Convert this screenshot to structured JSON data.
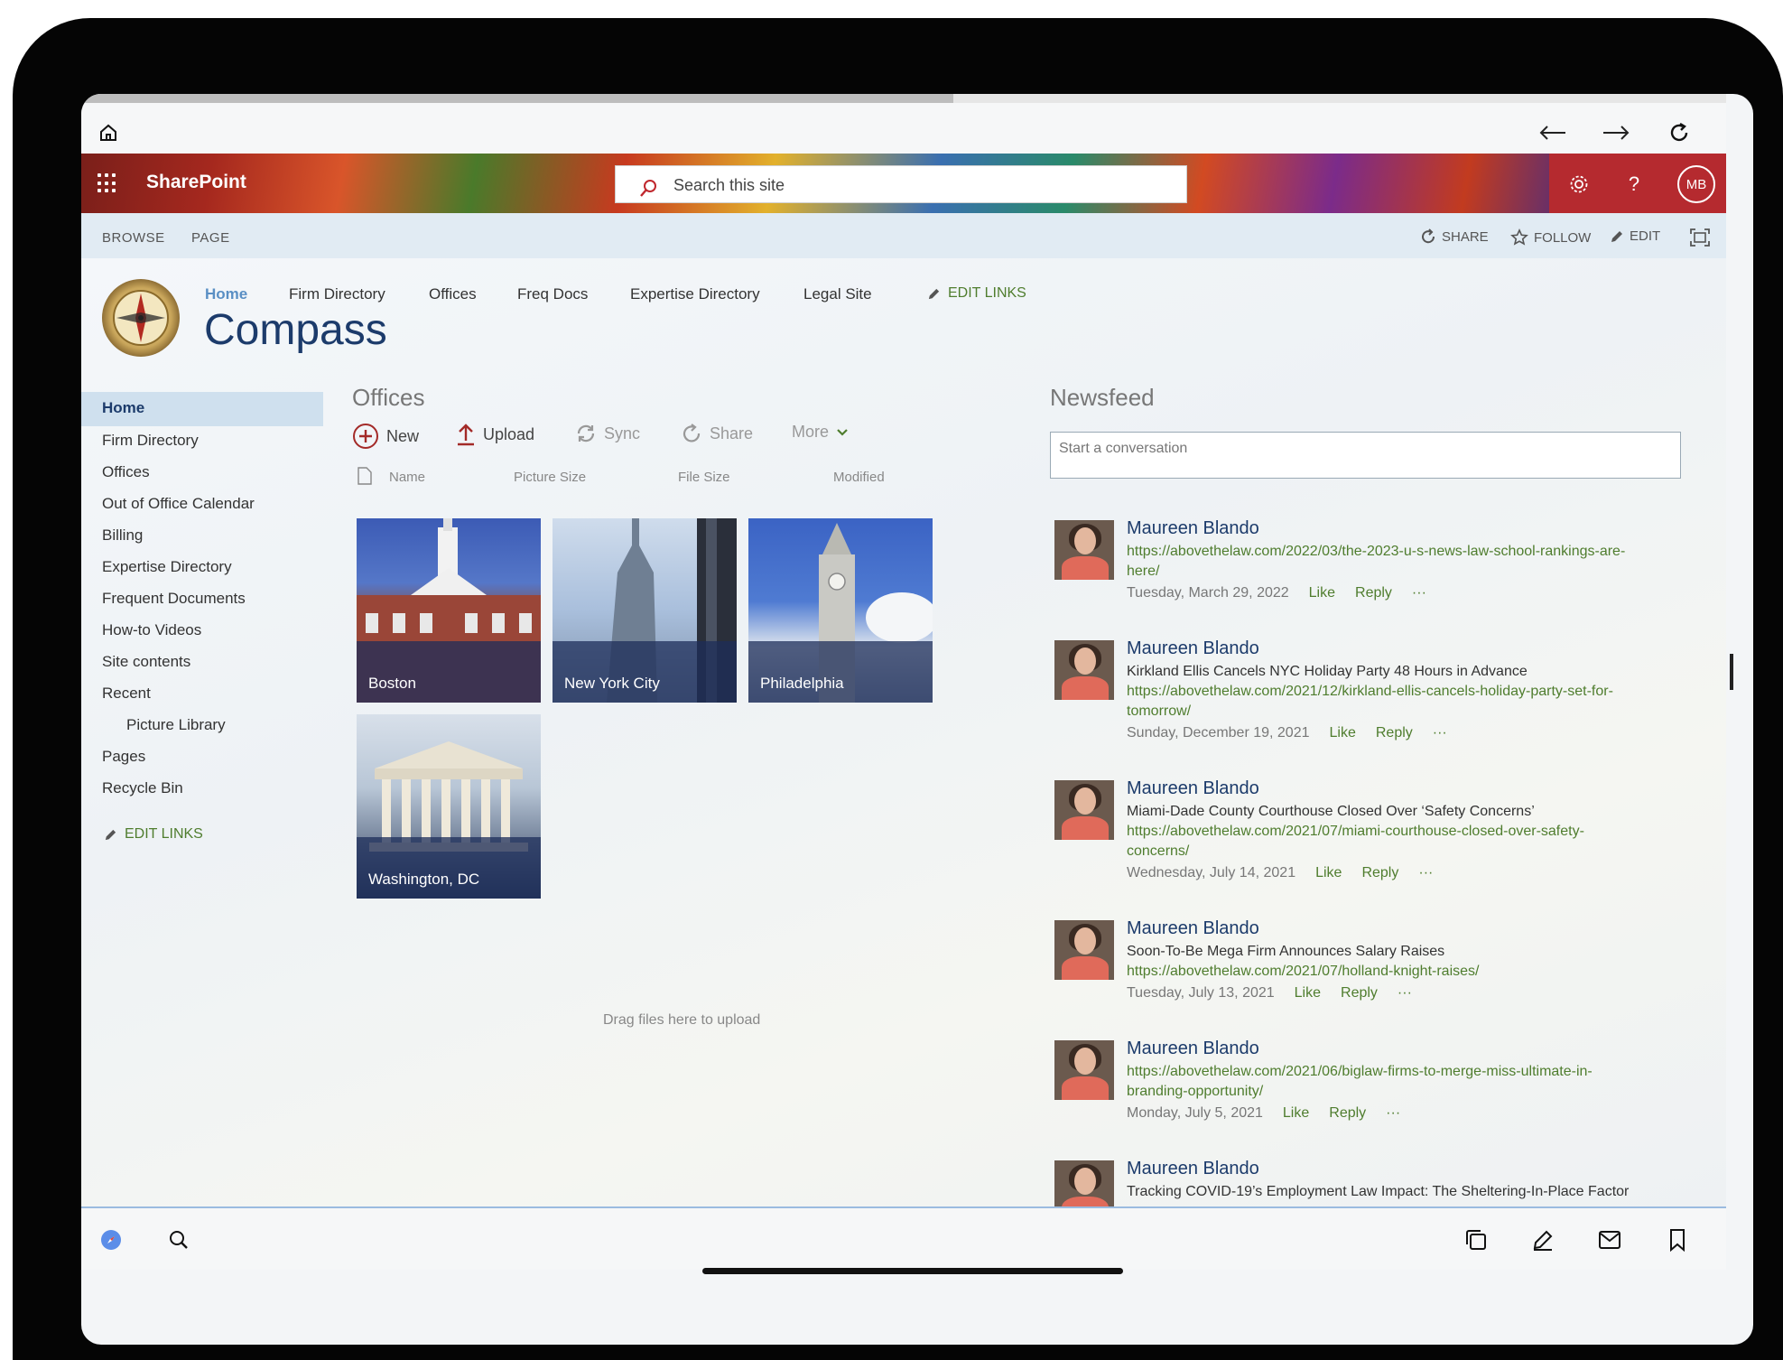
{
  "browser": {
    "loaded_fraction": 0.53
  },
  "suite": {
    "brand": "SharePoint",
    "search_placeholder": "Search this site",
    "avatar_initials": "MB",
    "help_label": "?"
  },
  "ribbon": {
    "tabs": [
      "BROWSE",
      "PAGE"
    ],
    "share": "SHARE",
    "follow": "FOLLOW",
    "edit": "EDIT"
  },
  "topnav": {
    "items": [
      "Home",
      "Firm Directory",
      "Offices",
      "Freq Docs",
      "Expertise Directory",
      "Legal Site"
    ],
    "edit_links": "EDIT LINKS"
  },
  "site_title": "Compass",
  "quicklaunch": {
    "items": [
      "Home",
      "Firm Directory",
      "Offices",
      "Out of Office Calendar",
      "Billing",
      "Expertise Directory",
      "Frequent Documents",
      "How-to Videos",
      "Site contents",
      "Recent",
      "Picture Library",
      "Pages",
      "Recycle Bin"
    ],
    "edit_links": "EDIT LINKS"
  },
  "offices": {
    "title": "Offices",
    "toolbar": {
      "new": "New",
      "upload": "Upload",
      "sync": "Sync",
      "share": "Share",
      "more": "More"
    },
    "columns": [
      "Name",
      "Picture Size",
      "File Size",
      "Modified"
    ],
    "tiles": [
      "Boston",
      "New York City",
      "Philadelphia",
      "Washington, DC"
    ],
    "drag_text": "Drag files here to upload"
  },
  "newsfeed": {
    "title": "Newsfeed",
    "placeholder": "Start a conversation",
    "like": "Like",
    "reply": "Reply",
    "more": "···",
    "posts": [
      {
        "author": "Maureen Blando",
        "headline": "",
        "link1": "https://abovethelaw.com/2022/03/the-2023-u-s-news-law-school-rankings-are-",
        "link2": "here/",
        "date": "Tuesday, March 29, 2022"
      },
      {
        "author": "Maureen Blando",
        "headline": "Kirkland Ellis Cancels NYC Holiday Party 48 Hours in Advance",
        "link1": "https://abovethelaw.com/2021/12/kirkland-ellis-cancels-holiday-party-set-for-",
        "link2": "tomorrow/",
        "date": "Sunday, December 19, 2021"
      },
      {
        "author": "Maureen Blando",
        "headline": "Miami-Dade County Courthouse Closed Over ‘Safety Concerns’",
        "link1": "https://abovethelaw.com/2021/07/miami-courthouse-closed-over-safety-",
        "link2": "concerns/",
        "date": "Wednesday, July 14, 2021"
      },
      {
        "author": "Maureen Blando",
        "headline": "Soon-To-Be Mega Firm Announces Salary Raises",
        "link1": "https://abovethelaw.com/2021/07/holland-knight-raises/",
        "link2": "",
        "date": "Tuesday, July 13, 2021"
      },
      {
        "author": "Maureen Blando",
        "headline": "",
        "link1": "https://abovethelaw.com/2021/06/biglaw-firms-to-merge-miss-ultimate-in-",
        "link2": "branding-opportunity/",
        "date": "Monday, July 5, 2021"
      },
      {
        "author": "Maureen Blando",
        "headline": "Tracking COVID-19’s Employment Law Impact: The Sheltering-In-Place Factor",
        "link1": "",
        "link2": "",
        "date": ""
      }
    ]
  },
  "colors": {
    "accent": "#4f7d2e",
    "title": "#1c3b6b",
    "suite_red": "#b52a2f"
  }
}
